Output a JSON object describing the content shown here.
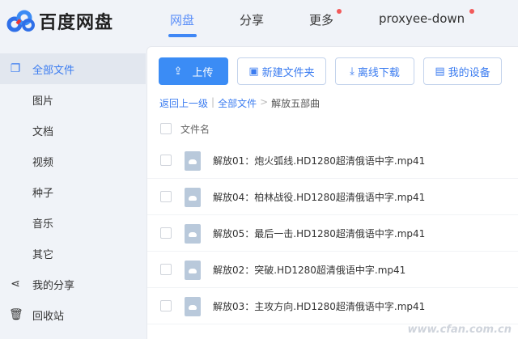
{
  "header": {
    "logo": "百度网盘",
    "nav": [
      {
        "label": "网盘",
        "active": true
      },
      {
        "label": "分享"
      },
      {
        "label": "更多",
        "dot": true
      },
      {
        "label": "proxyee-down",
        "dot": true
      }
    ]
  },
  "sidebar": {
    "items": [
      {
        "label": "全部文件",
        "icon": "files-icon",
        "active": true
      },
      {
        "label": "图片"
      },
      {
        "label": "文档"
      },
      {
        "label": "视频"
      },
      {
        "label": "种子"
      },
      {
        "label": "音乐"
      },
      {
        "label": "其它"
      },
      {
        "label": "我的分享",
        "icon": "share-icon"
      },
      {
        "label": "回收站",
        "icon": "trash-icon"
      }
    ]
  },
  "toolbar": {
    "upload": "上传",
    "new_folder": "新建文件夹",
    "offline_download": "离线下载",
    "my_devices": "我的设备"
  },
  "breadcrumb": {
    "back": "返回上一级",
    "sep": "|",
    "root": "全部文件",
    "arrow": ">",
    "current": "解放五部曲"
  },
  "list": {
    "header": "文件名",
    "files": [
      "解放01：炮火弧线.HD1280超清俄语中字.mp41",
      "解放04：柏林战役.HD1280超清俄语中字.mp41",
      "解放05：最后一击.HD1280超清俄语中字.mp41",
      "解放02：突破.HD1280超清俄语中字.mp41",
      "解放03：主攻方向.HD1280超清俄语中字.mp41"
    ]
  },
  "watermark": "www.cfan.com.cn",
  "colors": {
    "accent": "#3b8cf5",
    "dot": "#f25a5a"
  }
}
